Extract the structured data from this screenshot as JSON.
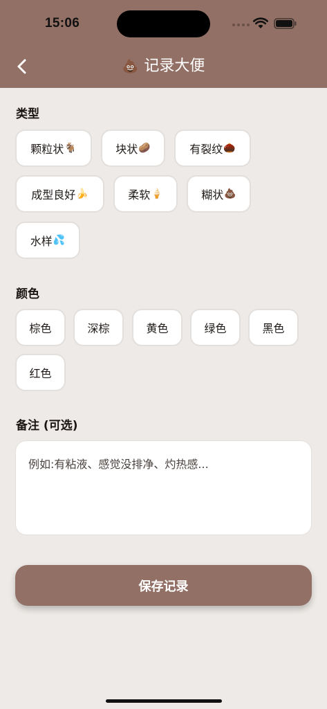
{
  "status_bar": {
    "time": "15:06"
  },
  "header": {
    "title_emoji": "💩",
    "title": "记录大便"
  },
  "type_section": {
    "label": "类型",
    "options": [
      {
        "text": "颗粒状",
        "emoji": "🐐"
      },
      {
        "text": "块状",
        "emoji": "🥔"
      },
      {
        "text": "有裂纹",
        "emoji": "🌰"
      },
      {
        "text": "成型良好",
        "emoji": "🍌"
      },
      {
        "text": "柔软",
        "emoji": "🍦"
      },
      {
        "text": "糊状",
        "emoji": "💩"
      },
      {
        "text": "水样",
        "emoji": "💦"
      }
    ]
  },
  "color_section": {
    "label": "颜色",
    "options": [
      "棕色",
      "深棕",
      "黄色",
      "绿色",
      "黑色",
      "红色"
    ]
  },
  "notes_section": {
    "label": "备注 (可选)",
    "placeholder": "例如:有粘液、感觉没排净、灼热感...",
    "value": ""
  },
  "save_label": "保存记录",
  "colors": {
    "header": "#927065",
    "background": "#EEEAE7",
    "chip_bg": "#FFFFFF"
  }
}
